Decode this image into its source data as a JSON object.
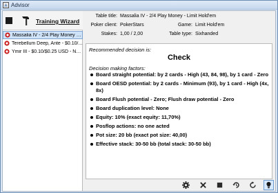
{
  "window": {
    "title": "Advisor"
  },
  "left": {
    "wizard_label": "Training Wizard",
    "tournaments": [
      {
        "label": "Massalia IV - 2/4 Play Money - L...",
        "selected": true
      },
      {
        "label": "Terebellum Deep, Ante - $0.10/...",
        "selected": false
      },
      {
        "label": "Ymir III - $0.10/$0.25 USD - No...",
        "selected": false
      }
    ]
  },
  "info": {
    "table_title_label": "Table title:",
    "table_title_value": "Massalia IV - 2/4 Play Money - Limit Hold'em",
    "poker_client_label": "Poker client:",
    "poker_client_value": "PokerStars",
    "stakes_label": "Stakes:",
    "stakes_value": "1,00 / 2,00",
    "game_label": "Game:",
    "game_value": "Limit Hold'em",
    "table_type_label": "Table type:",
    "table_type_value": "Sixhanded"
  },
  "advice": {
    "recommended_label": "Recommended decision is:",
    "decision": "Check",
    "factors_label": "Decision making factors:",
    "factors": [
      "Board straight potential: by 2 cards - High (43, 84, 98), by 1 card - Zero",
      "Board OESD potential: by 2 cards - Minimum (93), by 1 card - High (4x, 8x)",
      "Board Flush potential - Zero; Flush draw potential - Zero",
      "Board duplication level: None",
      "Equity: 10% (exact equity: 11,70%)",
      "Posflop actions: no one acted",
      "Pot size: 20 bb (exact pot size: 40,00)",
      "Effective stack: 30-50 bb (total stack: 30-50 bb)"
    ]
  },
  "toolbar": {
    "icons": [
      "gear-icon",
      "close-icon",
      "stop-icon",
      "history-icon",
      "forward-icon",
      "bulb-icon"
    ]
  }
}
